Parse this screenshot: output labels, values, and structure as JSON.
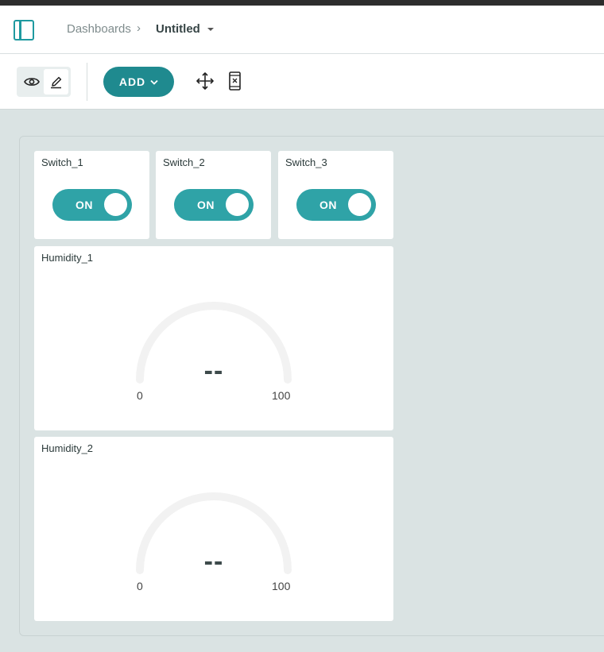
{
  "header": {
    "breadcrumb_root": "Dashboards",
    "breadcrumb_separator": "›",
    "breadcrumb_current": "Untitled"
  },
  "toolbar": {
    "add_label": "ADD"
  },
  "switches": [
    {
      "title": "Switch_1",
      "state": "ON"
    },
    {
      "title": "Switch_2",
      "state": "ON"
    },
    {
      "title": "Switch_3",
      "state": "ON"
    }
  ],
  "gauges": [
    {
      "title": "Humidity_1",
      "value": "--",
      "min": "0",
      "max": "100"
    },
    {
      "title": "Humidity_2",
      "value": "--",
      "min": "0",
      "max": "100"
    }
  ],
  "colors": {
    "accent": "#1f8a8f",
    "toggle": "#2fa3a7",
    "background": "#dae3e3"
  }
}
